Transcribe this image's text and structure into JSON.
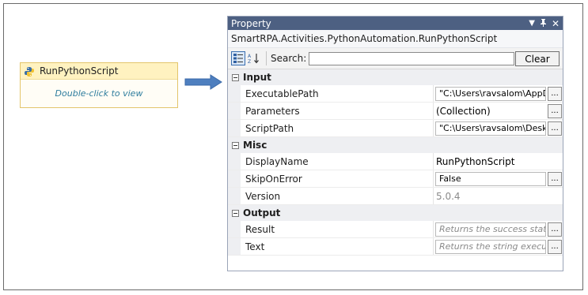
{
  "activity": {
    "title": "RunPythonScript",
    "hint": "Double-click to view",
    "icon": "python-icon"
  },
  "panel": {
    "title": "Property",
    "type_name": "SmartRPA.Activities.PythonAutomation.RunPythonScript",
    "title_icons": [
      "dropdown-icon",
      "pin-icon",
      "close-icon"
    ],
    "search_label": "Search:",
    "search_value": "",
    "clear_label": "Clear",
    "sections": [
      {
        "name": "Input",
        "rows": [
          {
            "name": "ExecutablePath",
            "value": "\"C:\\Users\\ravsalom\\AppD",
            "kind": "box",
            "ellipsis": true
          },
          {
            "name": "Parameters",
            "value": "(Collection)",
            "kind": "plain",
            "ellipsis": true
          },
          {
            "name": "ScriptPath",
            "value": "\"C:\\Users\\ravsalom\\Desk",
            "kind": "box",
            "ellipsis": true
          }
        ]
      },
      {
        "name": "Misc",
        "rows": [
          {
            "name": "DisplayName",
            "value": "RunPythonScript",
            "kind": "plain",
            "ellipsis": false
          },
          {
            "name": "SkipOnError",
            "value": "False",
            "kind": "box",
            "ellipsis": true
          },
          {
            "name": "Version",
            "value": "5.0.4",
            "kind": "gray",
            "ellipsis": false
          }
        ]
      },
      {
        "name": "Output",
        "rows": [
          {
            "name": "Result",
            "value": "Returns the success state",
            "kind": "placeholder",
            "ellipsis": true
          },
          {
            "name": "Text",
            "value": "Returns the string executi",
            "kind": "placeholder",
            "ellipsis": true
          }
        ]
      }
    ]
  },
  "colors": {
    "titlebar": "#4d6082",
    "activity_header": "#fff2c0",
    "arrow": "#4e7fbf",
    "hint_text": "#2e7d9e"
  }
}
